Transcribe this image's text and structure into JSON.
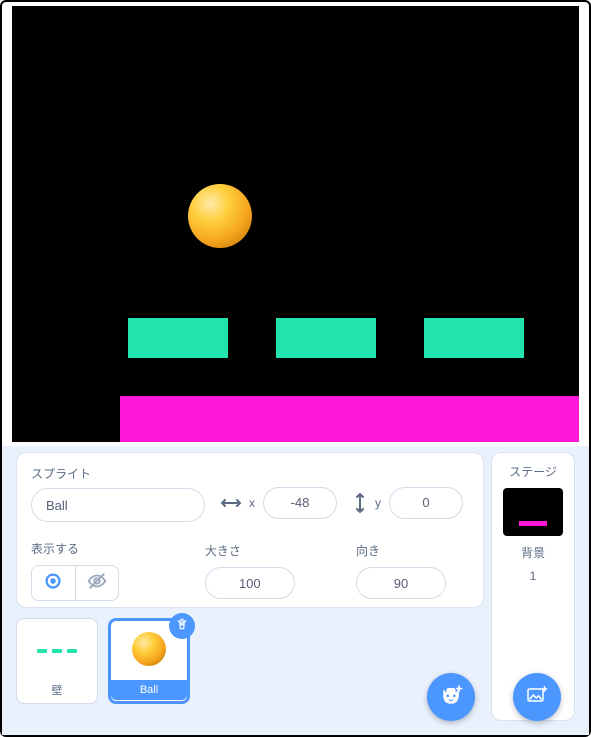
{
  "labels": {
    "sprite": "スプライト",
    "x": "x",
    "y": "y",
    "show": "表示する",
    "size": "大きさ",
    "direction": "向き",
    "stage": "ステージ",
    "backdrops": "背景"
  },
  "sprite_info": {
    "name": "Ball",
    "x": "-48",
    "y": "0",
    "size": "100",
    "direction": "90",
    "visible": true
  },
  "sprite_list": [
    {
      "id": "wall",
      "label": "壁",
      "selected": false
    },
    {
      "id": "ball",
      "label": "Ball",
      "selected": true
    }
  ],
  "backdrop_count": "1",
  "icons": {
    "h_arrows": "h-arrows-icon",
    "v_arrows": "v-arrows-icon",
    "eye": "eye-icon",
    "eye_off": "eye-off-icon",
    "trash": "trash-icon",
    "cat_plus": "cat-plus-icon",
    "image_plus": "image-plus-icon"
  },
  "colors": {
    "accent": "#4c97ff",
    "block": "#21e3ad",
    "floor": "#ff17d9",
    "ball_mid": "#f6a51e"
  }
}
